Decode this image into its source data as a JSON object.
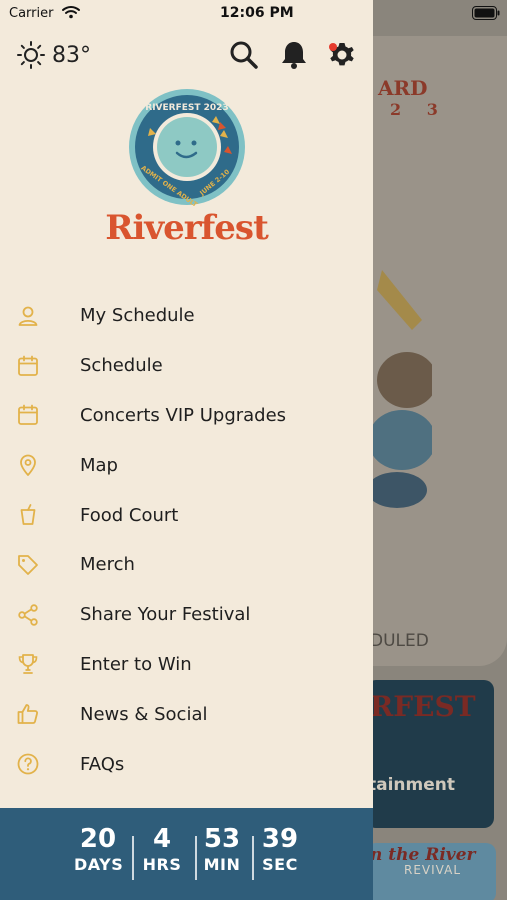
{
  "status_bar": {
    "carrier": "Carrier",
    "time": "12:06 PM"
  },
  "header": {
    "temperature": "83°"
  },
  "logo": {
    "badge_text_top": "RIVERFEST 2023",
    "badge_text_left": "ADMIT ONE ADULT",
    "badge_text_right": "JUNE 2-10",
    "brand_name": "Riverfest",
    "colors": {
      "brand": "#d9552f",
      "badge_blue": "#2f6b8a",
      "badge_teal": "#7fc1c5"
    }
  },
  "menu": {
    "items": [
      {
        "label": "My Schedule",
        "icon": "person-icon"
      },
      {
        "label": "Schedule",
        "icon": "calendar-icon"
      },
      {
        "label": "Concerts VIP Upgrades",
        "icon": "calendar-icon"
      },
      {
        "label": "Map",
        "icon": "map-pin-icon"
      },
      {
        "label": "Food Court",
        "icon": "cup-icon"
      },
      {
        "label": "Merch",
        "icon": "tag-icon"
      },
      {
        "label": "Share Your Festival",
        "icon": "share-icon"
      },
      {
        "label": "Enter to Win",
        "icon": "trophy-icon"
      },
      {
        "label": "News & Social",
        "icon": "thumbs-up-icon"
      },
      {
        "label": "FAQs",
        "icon": "help-circle-icon"
      }
    ],
    "icon_color": "#e2b24a"
  },
  "countdown": {
    "days": {
      "value": "20",
      "label": "DAYS"
    },
    "hours": {
      "value": "4",
      "label": "HRS"
    },
    "minutes": {
      "value": "53",
      "label": "MIN"
    },
    "seconds": {
      "value": "39",
      "label": "SEC"
    },
    "background": "#2f5d7a"
  },
  "background_screen": {
    "card_title": "ARD",
    "card_subtitle": "2 3",
    "scheduled_text": "DULED",
    "poster1_title": "RFEST",
    "poster1_text": "tainment",
    "poster2_text": "n the River",
    "poster2_sub": "REVIVAL"
  }
}
